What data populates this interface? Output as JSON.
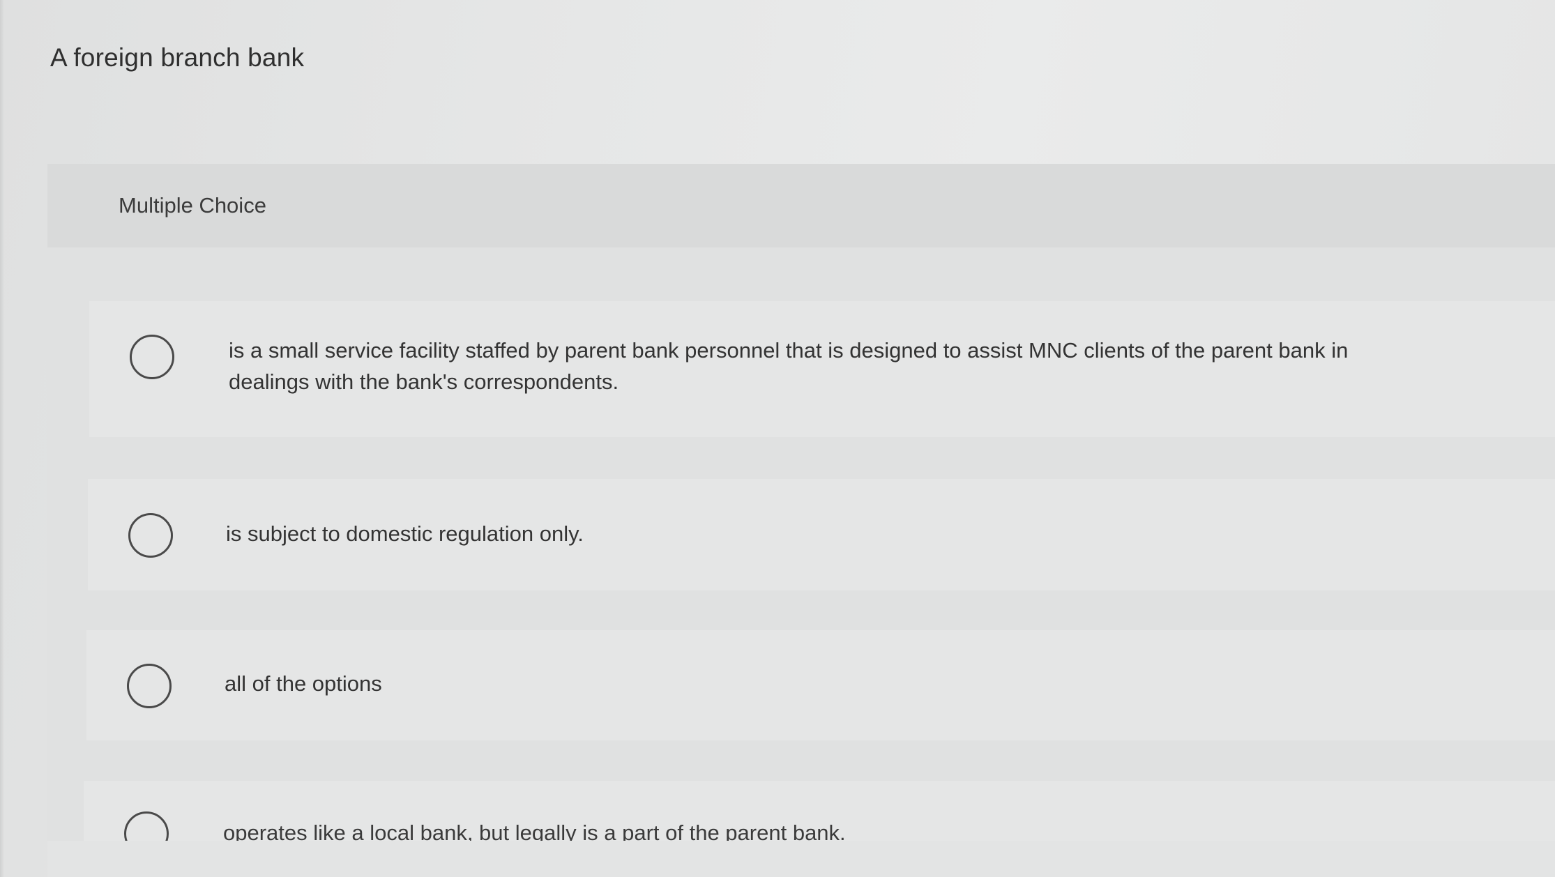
{
  "question": {
    "title": "A foreign branch bank"
  },
  "panel": {
    "type_label": "Multiple Choice"
  },
  "choices": [
    {
      "text": "is a small service facility staffed by parent bank personnel that is designed to assist MNC clients of the parent bank in dealings with the bank's correspondents.",
      "selected": false
    },
    {
      "text": "is subject to domestic regulation only.",
      "selected": false
    },
    {
      "text": "all of the options",
      "selected": false
    },
    {
      "text": "operates like a local bank, but legally is a part of the parent bank.",
      "selected": false
    }
  ]
}
